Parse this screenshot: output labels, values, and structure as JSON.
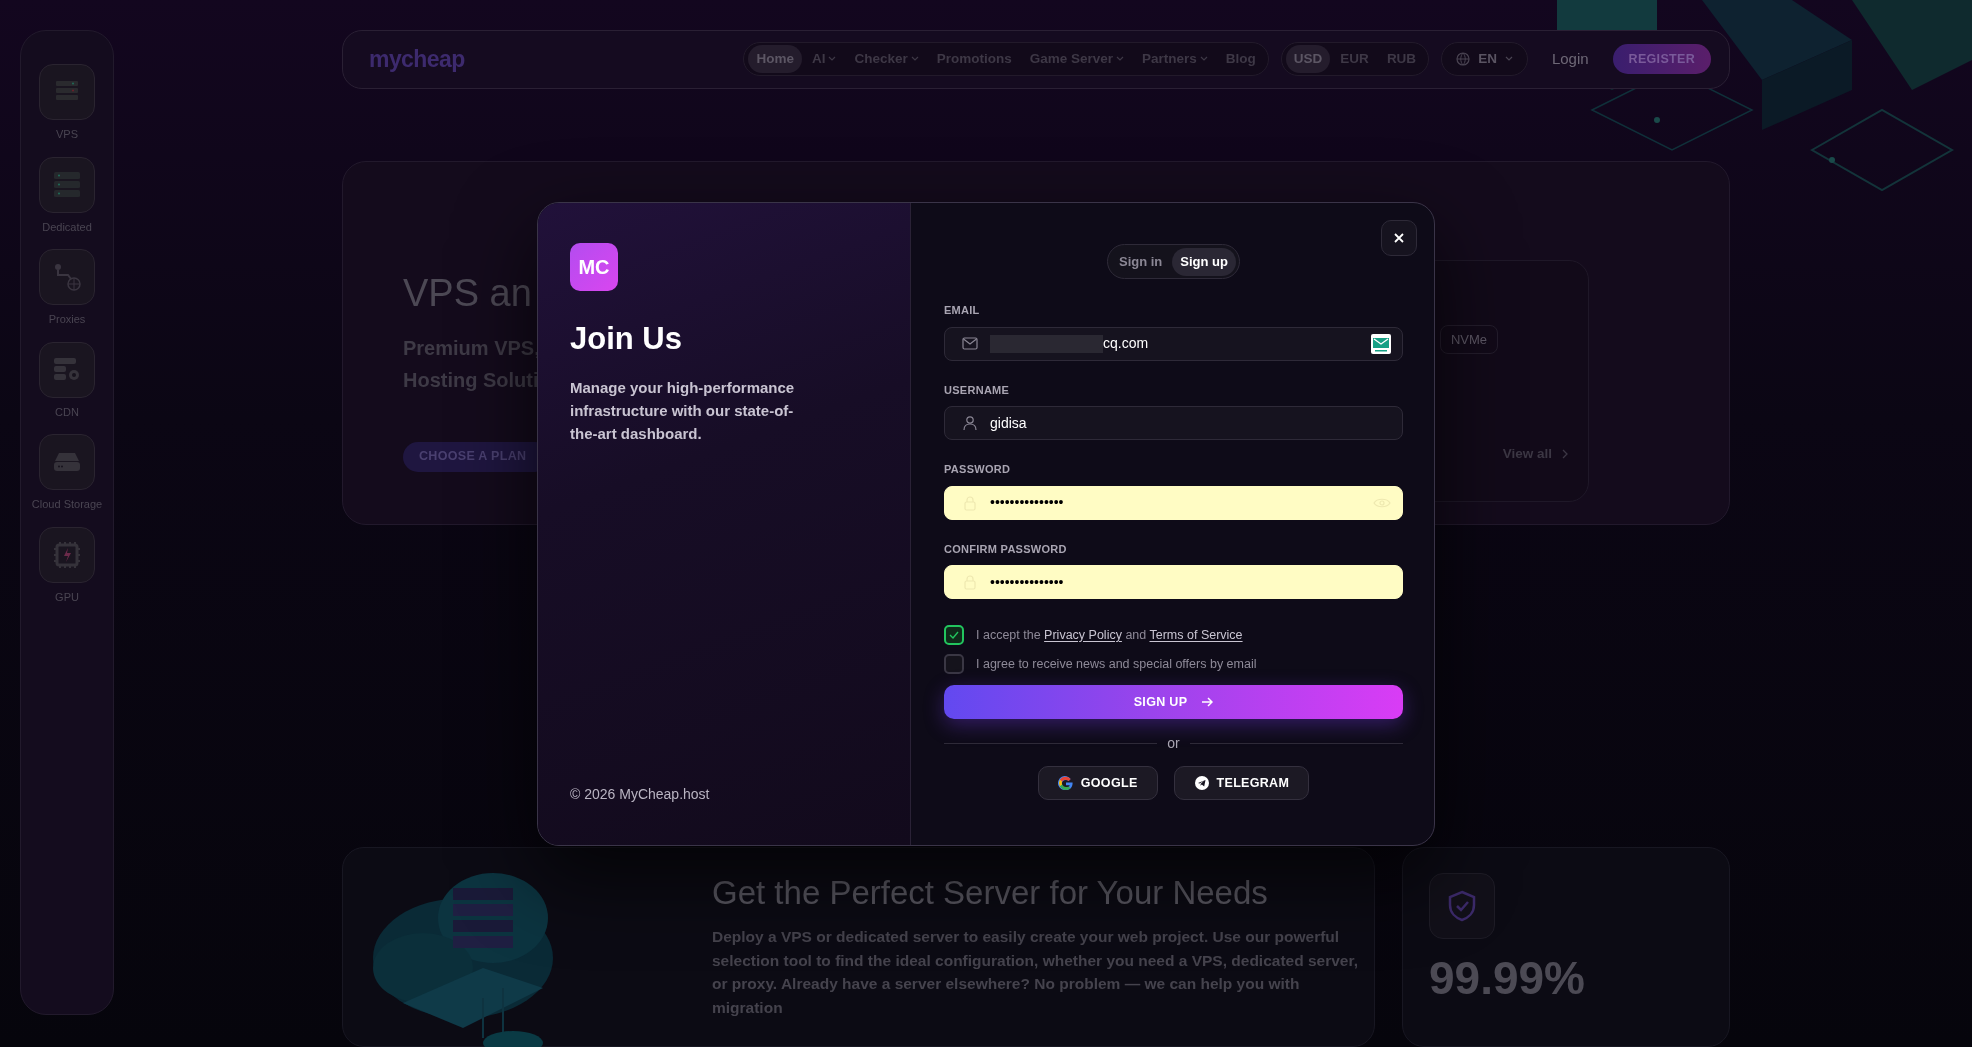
{
  "sidebar": {
    "items": [
      {
        "label": "VPS",
        "kind": "vps"
      },
      {
        "label": "Dedicated",
        "kind": "dedicated"
      },
      {
        "label": "Proxies",
        "kind": "proxies"
      },
      {
        "label": "CDN",
        "kind": "cdn"
      },
      {
        "label": "Cloud Storage",
        "kind": "storage"
      },
      {
        "label": "GPU",
        "kind": "gpu"
      }
    ]
  },
  "nav": {
    "logo": "mycheap",
    "links": [
      {
        "label": "Home",
        "selected": true,
        "dropdown": false
      },
      {
        "label": "AI",
        "selected": false,
        "dropdown": true
      },
      {
        "label": "Checker",
        "selected": false,
        "dropdown": true
      },
      {
        "label": "Promotions",
        "selected": false,
        "dropdown": false
      },
      {
        "label": "Game Server",
        "selected": false,
        "dropdown": true
      },
      {
        "label": "Partners",
        "selected": false,
        "dropdown": true
      },
      {
        "label": "Blog",
        "selected": false,
        "dropdown": false
      }
    ],
    "currencies": [
      {
        "label": "USD",
        "selected": true
      },
      {
        "label": "EUR",
        "selected": false
      },
      {
        "label": "RUB",
        "selected": false
      }
    ],
    "language": "EN",
    "login": "Login",
    "register": "REGISTER"
  },
  "hero": {
    "title": "VPS an",
    "subtitle_lines": [
      "Premium VPS,",
      "Hosting Soluti"
    ],
    "cta": "CHOOSE A PLAN",
    "tag": "NVMe",
    "view_all": "View all"
  },
  "modal": {
    "logo": "MC",
    "title": "Join Us",
    "description": "Manage your high-performance infrastructure with our state-of-the-art dashboard.",
    "copyright": "© 2026 MyCheap.host",
    "tabs": [
      {
        "label": "Sign in",
        "selected": false
      },
      {
        "label": "Sign up",
        "selected": true
      }
    ],
    "fields": [
      {
        "label": "EMAIL",
        "kind": "email",
        "value": "cq.com",
        "redacted": true,
        "autofilled": false
      },
      {
        "label": "USERNAME",
        "kind": "username",
        "value": "gidisa",
        "autofilled": false
      },
      {
        "label": "PASSWORD",
        "kind": "password",
        "value": "•••••••••••••••",
        "autofilled": true
      },
      {
        "label": "CONFIRM PASSWORD",
        "kind": "password",
        "value": "•••••••••••••••",
        "autofilled": true
      }
    ],
    "checkboxes": [
      {
        "checked": true,
        "parts": [
          {
            "text": "I accept the "
          },
          {
            "link": "Privacy Policy"
          },
          {
            "text": " and "
          },
          {
            "link": "Terms of Service"
          }
        ]
      },
      {
        "checked": false,
        "parts": [
          {
            "text": "I agree to receive news and special offers by email"
          }
        ]
      }
    ],
    "submit": "SIGN UP",
    "divider": "or",
    "social": [
      {
        "label": "GOOGLE",
        "kind": "google"
      },
      {
        "label": "TELEGRAM",
        "kind": "telegram"
      }
    ]
  },
  "features": {
    "title": "Get the Perfect Server for Your Needs",
    "description": "Deploy a VPS or dedicated server to easily create your web project. Use our powerful selection tool to find the ideal configuration, whether you need a VPS, dedicated server, or proxy. Already have a server elsewhere? No problem — we can help you with migration",
    "stat": "99.99%"
  }
}
